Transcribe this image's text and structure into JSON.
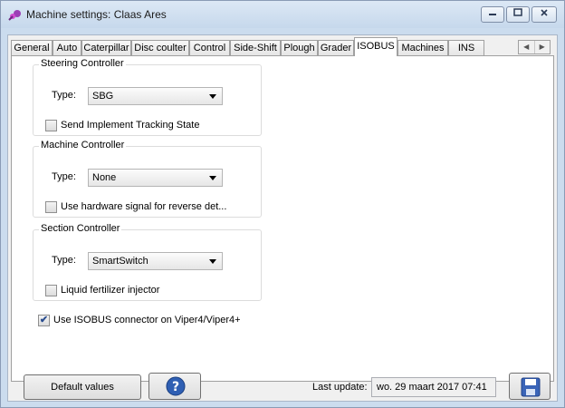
{
  "window": {
    "title": "Machine settings: Claas Ares"
  },
  "tabs": [
    {
      "label": "General"
    },
    {
      "label": "Auto"
    },
    {
      "label": "Caterpillar"
    },
    {
      "label": "Disc coulter"
    },
    {
      "label": "Control"
    },
    {
      "label": "Side-Shift"
    },
    {
      "label": "Plough"
    },
    {
      "label": "Grader"
    },
    {
      "label": "ISOBUS",
      "active": true
    },
    {
      "label": "Machines"
    },
    {
      "label": "INS"
    }
  ],
  "steering_controller": {
    "title": "Steering Controller",
    "type_label": "Type:",
    "type_value": "SBG",
    "checkbox_label": "Send Implement Tracking State",
    "checked": false
  },
  "machine_controller": {
    "title": "Machine Controller",
    "type_label": "Type:",
    "type_value": "None",
    "checkbox_label": "Use hardware signal for reverse det...",
    "checked": false
  },
  "section_controller": {
    "title": "Section Controller",
    "type_label": "Type:",
    "type_value": "SmartSwitch",
    "checkbox_label": "Liquid fertilizer injector",
    "checked": false
  },
  "isobus_connector": {
    "label": "Use ISOBUS connector on Viper4/Viper4+",
    "checked": true
  },
  "footer": {
    "default_values_label": "Default values",
    "help_icon": "question-mark-icon",
    "last_update_label": "Last update:",
    "last_update_value": "wo. 29 maart 2017 07:41",
    "save_icon": "floppy-disk-icon"
  },
  "colors": {
    "title_bar": "#c6d8ec",
    "help_button": "#2f5fb3",
    "checkmark": "#2a4d8f"
  }
}
